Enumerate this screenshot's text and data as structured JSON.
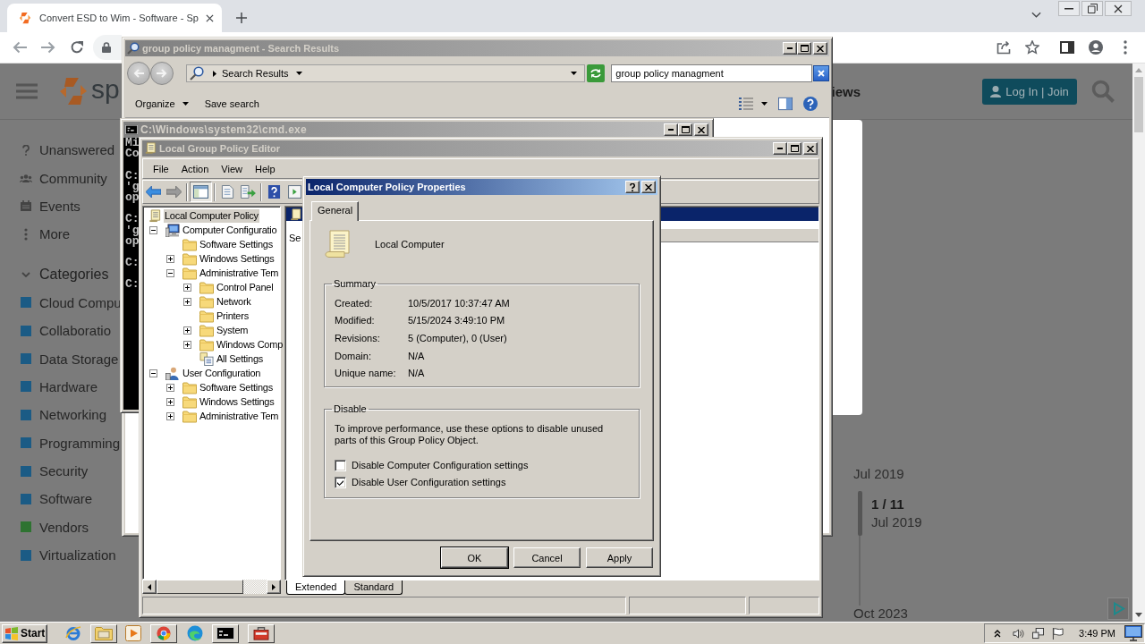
{
  "browser": {
    "tab_title": "Convert ESD to Wim - Software - Sp",
    "page": {
      "logo_text": "sp",
      "nav_text": "iews",
      "login_button": "Log In | Join",
      "sidebar_links": [
        {
          "label": "Unanswered",
          "kind": "question"
        },
        {
          "label": "Community",
          "kind": "people"
        },
        {
          "label": "Events",
          "kind": "calendar"
        },
        {
          "label": "More",
          "kind": "more"
        }
      ],
      "categories": {
        "heading": "Categories",
        "expanded": true,
        "items": [
          {
            "label": "Cloud Compu",
            "color": "#1b5b85"
          },
          {
            "label": "Collaboratio",
            "color": "#1b5b85"
          },
          {
            "label": "Data Storage",
            "color": "#1b5b85"
          },
          {
            "label": "Hardware",
            "color": "#1b5b85"
          },
          {
            "label": "Networking",
            "color": "#1b5b85"
          },
          {
            "label": "Programming",
            "color": "#1b5b85"
          },
          {
            "label": "Security",
            "color": "#1b5b85"
          },
          {
            "label": "Software",
            "color": "#1b5b85"
          },
          {
            "label": "Vendors",
            "color": "#2e7331"
          },
          {
            "label": "Virtualization",
            "color": "#1b5b85"
          }
        ]
      },
      "timeline": {
        "start": "Jul 2019",
        "position": "1 / 11",
        "position_date": "Jul 2019",
        "end": "Oct 2023"
      }
    }
  },
  "windows": {
    "search": {
      "title": "group policy managment - Search Results",
      "active": false,
      "location": "Search Results",
      "query": "group policy managment",
      "commands": [
        {
          "label": "Organize",
          "kind": "menu"
        },
        {
          "label": "Save search",
          "kind": "button"
        }
      ]
    },
    "cmd": {
      "title": "C:\\Windows\\system32\\cmd.exe",
      "active": false,
      "output": [
        [
          "Mi",
          "Co"
        ],
        [
          "C:",
          "'g",
          "op"
        ],
        [
          "C:",
          "'g",
          "op"
        ],
        [
          "C:"
        ],
        [
          "C:"
        ]
      ]
    },
    "gpe": {
      "title": "Local Group Policy Editor",
      "active": false,
      "menu": [
        "File",
        "Action",
        "View",
        "Help"
      ],
      "tree": [
        {
          "label": "Local Computer Policy",
          "kind": "policy",
          "selected": true,
          "children": [
            {
              "label": "Computer Configuratio",
              "kind": "computer",
              "selected": false,
              "expanded": true,
              "children": [
                {
                  "label": "Software Settings",
                  "kind": "folder",
                  "selected": false
                },
                {
                  "label": "Windows Settings",
                  "kind": "folder",
                  "selected": false,
                  "expanded": false
                },
                {
                  "label": "Administrative Tem",
                  "kind": "folder",
                  "selected": false,
                  "expanded": true,
                  "children": [
                    {
                      "label": "Control Panel",
                      "kind": "folder",
                      "selected": false,
                      "expanded": false
                    },
                    {
                      "label": "Network",
                      "kind": "folder",
                      "selected": false,
                      "expanded": false
                    },
                    {
                      "label": "Printers",
                      "kind": "folder",
                      "selected": false
                    },
                    {
                      "label": "System",
                      "kind": "folder",
                      "selected": false,
                      "expanded": false
                    },
                    {
                      "label": "Windows Comp",
                      "kind": "folder",
                      "selected": false,
                      "expanded": false
                    },
                    {
                      "label": "All Settings",
                      "kind": "settings",
                      "selected": false
                    }
                  ]
                }
              ]
            },
            {
              "label": "User Configuration",
              "kind": "user",
              "selected": false,
              "expanded": true,
              "children": [
                {
                  "label": "Software Settings",
                  "kind": "folder",
                  "selected": false,
                  "expanded": false
                },
                {
                  "label": "Windows Settings",
                  "kind": "folder",
                  "selected": false,
                  "expanded": false
                },
                {
                  "label": "Administrative Tem",
                  "kind": "folder",
                  "selected": false,
                  "expanded": false
                }
              ]
            }
          ]
        }
      ],
      "details_text": "Se",
      "view_tabs": [
        {
          "label": "Extended",
          "selected": true
        },
        {
          "label": "Standard",
          "selected": false
        }
      ]
    },
    "dialog": {
      "title": "Local Computer Policy Properties",
      "active": true,
      "tabs": [
        {
          "label": "General",
          "selected": true
        }
      ],
      "object_name": "Local Computer",
      "summary": {
        "legend": "Summary",
        "rows": [
          {
            "label": "Created:",
            "value": "10/5/2017 10:37:47 AM"
          },
          {
            "label": "Modified:",
            "value": "5/15/2024 3:49:10 PM"
          },
          {
            "label": "Revisions:",
            "value": "5 (Computer), 0 (User)"
          },
          {
            "label": "Domain:",
            "value": "N/A"
          },
          {
            "label": "Unique name:",
            "value": "N/A"
          }
        ]
      },
      "disable": {
        "legend": "Disable",
        "description": "To improve performance, use these options to disable unused parts of this Group Policy Object.",
        "options": [
          {
            "label": "Disable Computer Configuration settings",
            "checked": false
          },
          {
            "label": "Disable User Configuration settings",
            "checked": true
          }
        ]
      },
      "buttons": [
        {
          "label": "OK",
          "default": true
        },
        {
          "label": "Cancel",
          "default": false
        },
        {
          "label": "Apply",
          "default": false
        }
      ]
    }
  },
  "taskbar": {
    "start": "Start",
    "clock": "3:49 PM"
  }
}
